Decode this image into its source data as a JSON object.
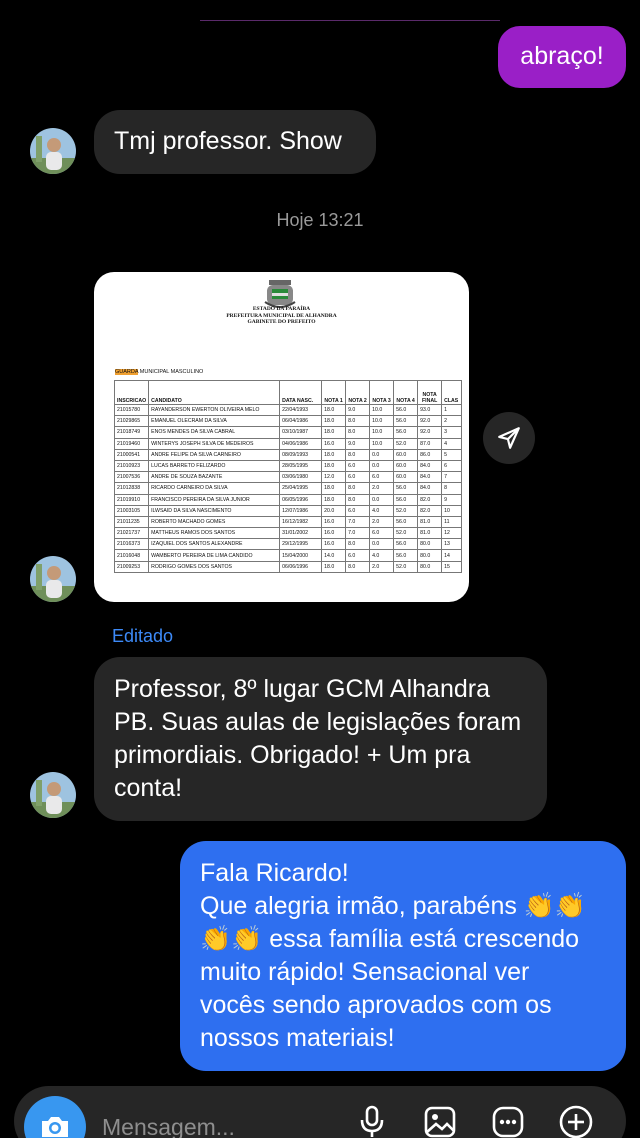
{
  "messages": {
    "sent_1": "abraço!",
    "received_1": "Tmj professor. Show",
    "timestamp": "Hoje 13:21",
    "edited_label": "Editado",
    "received_2": "Professor, 8º lugar GCM Alhandra PB. Suas aulas de legislações foram primordiais. Obrigado! + Um pra conta!",
    "sent_2_lines": [
      "Fala Ricardo!",
      "Que alegria irmão,  parabéns 👏👏",
      "👏👏 essa família está crescendo",
      "muito rápido! Sensacional ver",
      "vocês sendo aprovados com os",
      "nossos materiais!"
    ]
  },
  "document": {
    "header_lines": [
      "ESTADO DA PARAÍBA",
      "PREFEITURA MUNICIPAL DE ALHANDRA",
      "GABINETE DO PREFEITO"
    ],
    "subtitle_highlight": "GUARDA",
    "subtitle_rest": " MUNICIPAL MASCULINO",
    "columns": [
      "INSCRICAO",
      "CANDIDATO",
      "DATA NASC.",
      "NOTA 1",
      "NOTA 2",
      "NOTA 3",
      "NOTA 4",
      "NOTA FINAL",
      "CLAS"
    ],
    "rows": [
      [
        "21015780",
        "RAYANDERSON EWERTON OLIVEIRA MELO",
        "22/04/1993",
        "18.0",
        "9.0",
        "10.0",
        "56.0",
        "93.0",
        "1"
      ],
      [
        "21029865",
        "EMANUEL OLECRAM DA SILVA",
        "06/04/1986",
        "18.0",
        "8.0",
        "10.0",
        "56.0",
        "92.0",
        "2"
      ],
      [
        "21018749",
        "ENOS MENDES DA SILVA CABRAL",
        "03/10/1987",
        "18.0",
        "8.0",
        "10.0",
        "56.0",
        "92.0",
        "3"
      ],
      [
        "21019460",
        "WINTERYS JOSEPH SILVA DE MEDEIROS",
        "04/06/1986",
        "16.0",
        "9.0",
        "10.0",
        "52.0",
        "87.0",
        "4"
      ],
      [
        "21000541",
        "ANDRE FELIPE DA SILVA CARNEIRO",
        "08/09/1993",
        "18.0",
        "8.0",
        "0.0",
        "60.0",
        "86.0",
        "5"
      ],
      [
        "21010923",
        "LUCAS BARRETO FELIZARDO",
        "28/05/1995",
        "18.0",
        "6.0",
        "0.0",
        "60.0",
        "84.0",
        "6"
      ],
      [
        "21007536",
        "ANDRE DE SOUZA BAZANTE",
        "03/06/1980",
        "12.0",
        "6.0",
        "6.0",
        "60.0",
        "84.0",
        "7"
      ],
      [
        "21012838",
        "RICARDO CARNEIRO DA SILVA",
        "25/04/1995",
        "18.0",
        "8.0",
        "2.0",
        "56.0",
        "84.0",
        "8"
      ],
      [
        "21019910",
        "FRANCISCO PEREIRA DA SILVA JUNIOR",
        "06/05/1996",
        "18.0",
        "8.0",
        "0.0",
        "56.0",
        "82.0",
        "9"
      ],
      [
        "21003105",
        "ILWSAID DA SILVA NASCIMENTO",
        "12/07/1986",
        "20.0",
        "6.0",
        "4.0",
        "52.0",
        "82.0",
        "10"
      ],
      [
        "21011235",
        "ROBERTO MACHADO GOMES",
        "16/12/1982",
        "16.0",
        "7.0",
        "2.0",
        "56.0",
        "81.0",
        "11"
      ],
      [
        "21021737",
        "MATTHEUS RAMOS DOS SANTOS",
        "31/01/2002",
        "16.0",
        "7.0",
        "6.0",
        "52.0",
        "81.0",
        "12"
      ],
      [
        "21016373",
        "IZAQUIEL DOS SANTOS ALEXANDRE",
        "29/12/1995",
        "16.0",
        "8.0",
        "0.0",
        "56.0",
        "80.0",
        "13"
      ],
      [
        "21016048",
        "WAMBERTO PEREIRA DE LIMA CANDIDO",
        "15/04/2000",
        "14.0",
        "6.0",
        "4.0",
        "56.0",
        "80.0",
        "14"
      ],
      [
        "21009253",
        "RODRIGO GOMES DOS SANTOS",
        "06/06/1996",
        "18.0",
        "8.0",
        "2.0",
        "52.0",
        "80.0",
        "15"
      ]
    ]
  },
  "composer": {
    "placeholder": "Mensagem..."
  },
  "icons": {
    "share": "paper-plane-icon",
    "camera": "camera-icon",
    "mic": "microphone-icon",
    "gallery": "gallery-icon",
    "sticker": "sticker-icon",
    "plus": "plus-icon"
  },
  "colors": {
    "purple_bubble": "#9a1fc7",
    "blue_bubble": "#2e6ff0",
    "received_bubble": "#262626",
    "edited": "#3d8af7",
    "camera_button": "#3897f0"
  }
}
